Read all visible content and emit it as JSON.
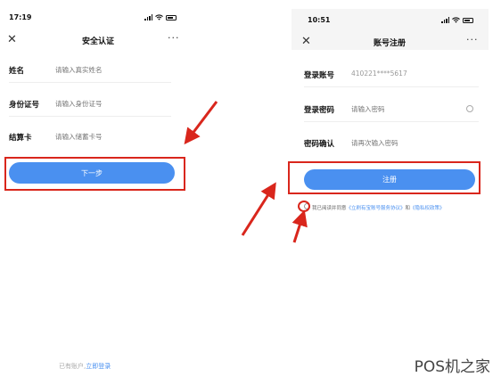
{
  "left_screen": {
    "status_time": "17:19",
    "nav": {
      "title": "安全认证",
      "close": "✕",
      "more": "···"
    },
    "fields": [
      {
        "label": "姓名",
        "placeholder": "请输入真实姓名"
      },
      {
        "label": "身份证号",
        "placeholder": "请输入身份证号"
      },
      {
        "label": "结算卡",
        "placeholder": "请输入储蓄卡号"
      }
    ],
    "next_button": "下一步",
    "footer": {
      "text": "已有账户,",
      "link": "立即登录"
    }
  },
  "right_screen": {
    "status_time": "10:51",
    "nav": {
      "title": "账号注册",
      "close": "✕",
      "more": "···"
    },
    "fields": [
      {
        "label": "登录账号",
        "value": "410221****5617"
      },
      {
        "label": "登录密码",
        "placeholder": "请输入密码"
      },
      {
        "label": "密码确认",
        "placeholder": "请再次输入密码"
      }
    ],
    "register_button": "注册",
    "agreement": {
      "text": "我已阅读并同意",
      "link1": "《立刷有宝账号服务协议》",
      "and": "和",
      "link2": "《隐私权政策》"
    }
  },
  "watermark": "POS机之家",
  "accent_colors": {
    "primary": "#4a90f0",
    "annotation": "#d9261c"
  },
  "icons": [
    "signal-icon",
    "wifi-icon",
    "battery-icon",
    "close-icon",
    "more-icon",
    "eye-icon",
    "arrow-icon"
  ]
}
